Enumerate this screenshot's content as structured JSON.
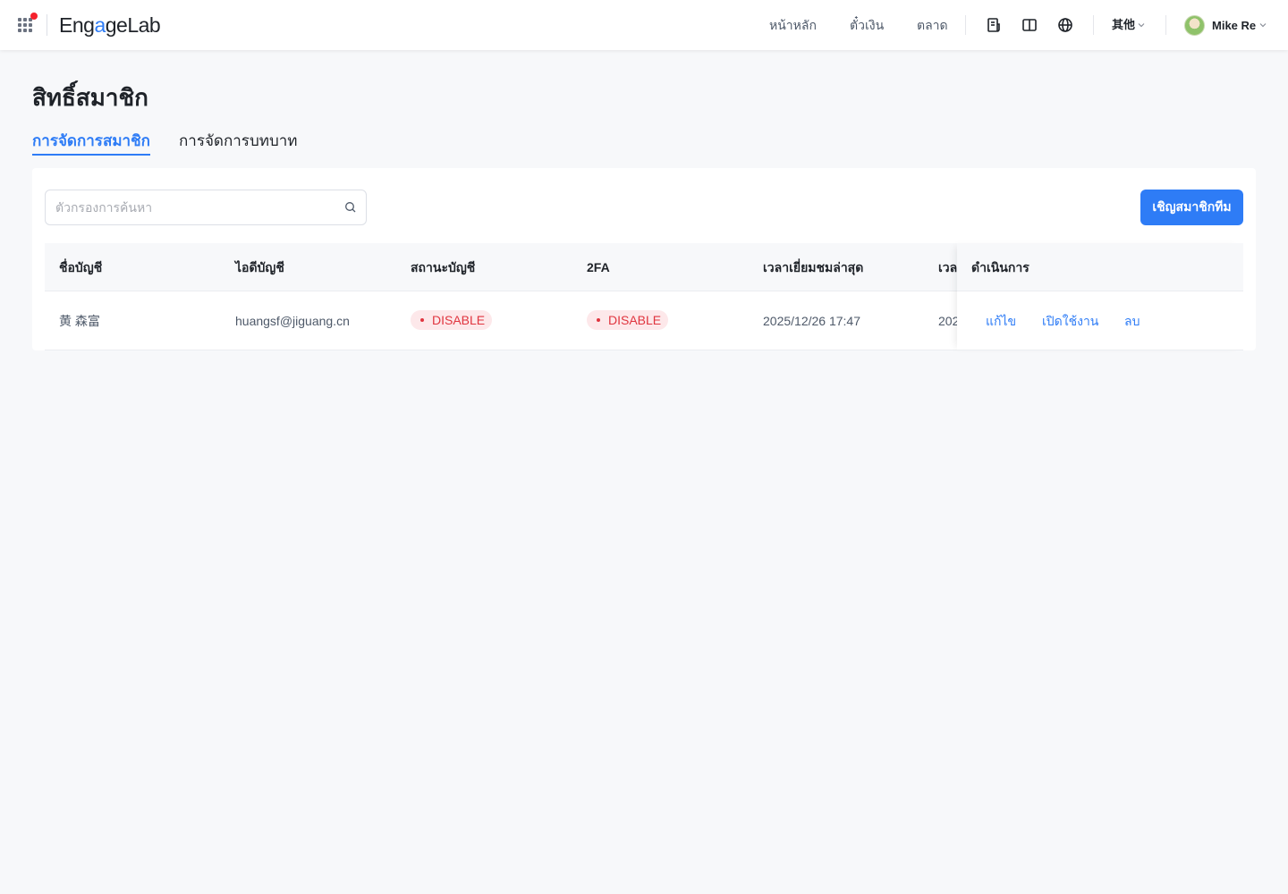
{
  "header": {
    "logo_text_a": "Eng",
    "logo_text_accent": "a",
    "logo_text_b": "geLab",
    "nav": [
      "หน้าหลัก",
      "ตั๋วเงิน",
      "ตลาด"
    ],
    "language_label": "其他",
    "user_name": "Mike Re"
  },
  "page": {
    "title": "สิทธิ์สมาชิก",
    "tabs": [
      {
        "label": "การจัดการสมาชิก",
        "active": true
      },
      {
        "label": "การจัดการบทบาท",
        "active": false
      }
    ]
  },
  "toolbar": {
    "search_placeholder": "ตัวกรองการค้นหา",
    "invite_label": "เชิญสมาชิกทีม"
  },
  "table": {
    "columns": [
      "ชื่อบัญชี",
      "ไอดีบัญชี",
      "สถานะบัญชี",
      "2FA",
      "เวลาเยี่ยมชมล่าสุด",
      "เวลา",
      "ดำเนินการ"
    ],
    "rows": [
      {
        "name": "黄 森富",
        "account_id": "huangsf@jiguang.cn",
        "status": "DISABLE",
        "twofa": "DISABLE",
        "last_visit": "2025/12/26 17:47",
        "time_partial": "202",
        "actions": [
          "แก้ไข",
          "เปิดใช้งาน",
          "ลบ"
        ]
      }
    ]
  },
  "colors": {
    "primary": "#2e7cf6",
    "danger": "#e0353f",
    "danger_bg": "#fde8ea",
    "notification_badge": "#f5222d"
  },
  "icons": {
    "apps": "apps-grid-icon",
    "docs": "document-icon",
    "book": "book-icon",
    "globe": "globe-icon",
    "search": "search-icon",
    "chevron": "chevron-down-icon"
  }
}
